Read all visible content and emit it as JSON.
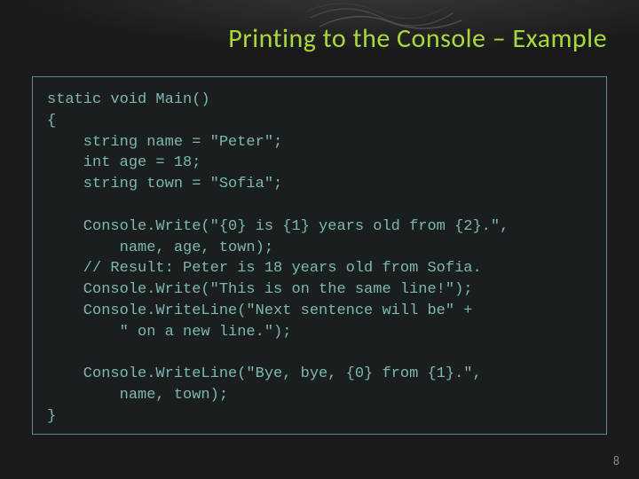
{
  "slide": {
    "title": "Printing to the Console – Example",
    "page_number": "8"
  },
  "code": {
    "lines": [
      "static void Main()",
      "{",
      "    string name = \"Peter\";",
      "    int age = 18;",
      "    string town = \"Sofia\";",
      "",
      "    Console.Write(\"{0} is {1} years old from {2}.\",",
      "        name, age, town);",
      "    // Result: Peter is 18 years old from Sofia.",
      "    Console.Write(\"This is on the same line!\");",
      "    Console.WriteLine(\"Next sentence will be\" +",
      "        \" on a new line.\");",
      "",
      "    Console.WriteLine(\"Bye, bye, {0} from {1}.\",",
      "        name, town);",
      "}"
    ]
  }
}
